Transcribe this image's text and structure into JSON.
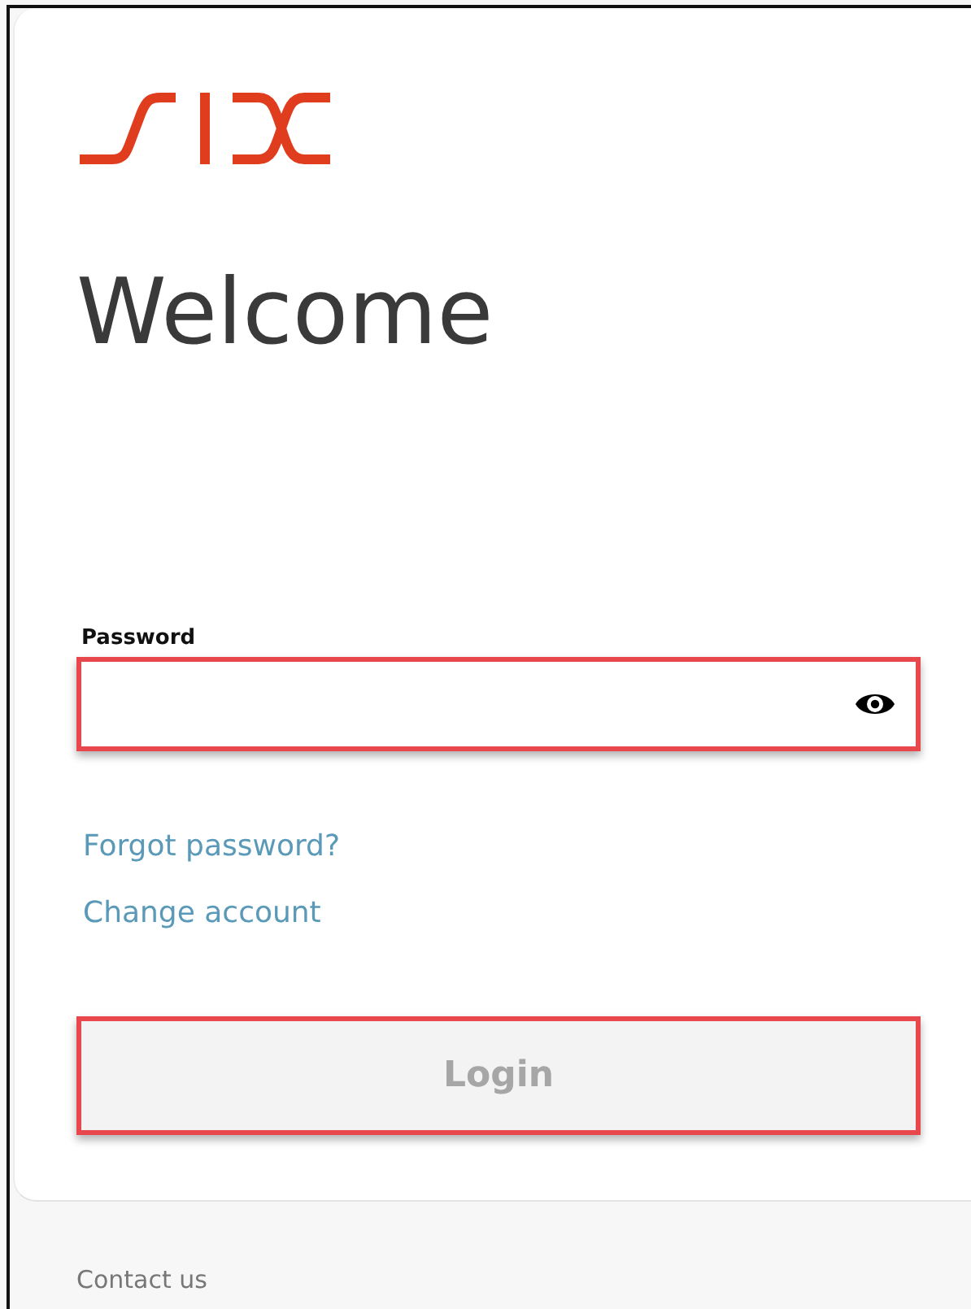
{
  "heading": "Welcome",
  "password_field": {
    "label": "Password",
    "highlighted": true
  },
  "links": [
    "Forgot password?",
    "Change account"
  ],
  "login_button": {
    "label": "Login",
    "disabled": true,
    "highlighted": true
  },
  "footer": {
    "links": [
      "Contact us"
    ]
  }
}
